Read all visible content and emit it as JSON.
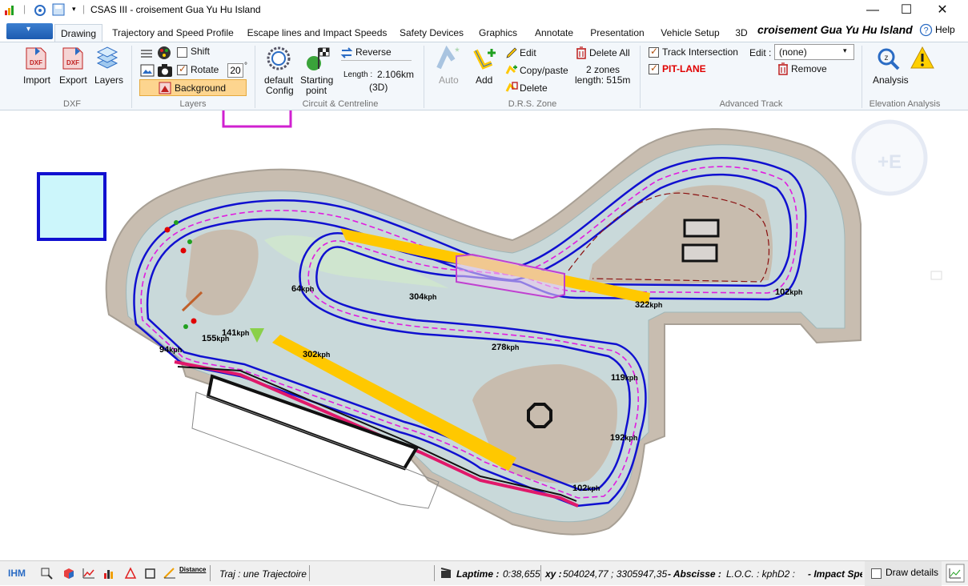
{
  "window": {
    "title": "CSAS III - croisement Gua Yu Hu Island",
    "controls": [
      "minimize-icon",
      "maximize-icon",
      "close-icon"
    ]
  },
  "tabs": [
    {
      "label": "Drawing",
      "active": true
    },
    {
      "label": "Trajectory and Speed Profile"
    },
    {
      "label": "Escape lines and Impact Speeds"
    },
    {
      "label": "Safety Devices"
    },
    {
      "label": "Graphics"
    },
    {
      "label": "Annotate"
    },
    {
      "label": "Presentation"
    },
    {
      "label": "Vehicle Setup"
    },
    {
      "label": "3D"
    }
  ],
  "project_name": "croisement Gua Yu Hu Island",
  "help_label": "Help",
  "ribbon": {
    "dxf": {
      "import": "Import",
      "export": "Export",
      "layers": "Layers",
      "group": "DXF"
    },
    "layers": {
      "shift": "Shift",
      "rotate": "Rotate",
      "rotate_value": "20",
      "rotate_unit": "°",
      "background": "Background",
      "group": "Layers"
    },
    "circuit": {
      "default_config": "default\nConfig",
      "default_1": "default",
      "default_2": "Config",
      "start_1": "Starting",
      "start_2": "point",
      "reverse": "Reverse",
      "length_label": "Length :",
      "length_value": "2.106km",
      "length_mode": "(3D)",
      "group": "Circuit & Centreline"
    },
    "drs": {
      "auto": "Auto",
      "add": "Add",
      "edit": "Edit",
      "copy_paste": "Copy/paste",
      "delete": "Delete",
      "delete_all": "Delete All",
      "zones": "2 zones",
      "zones_length": "length: 515m",
      "group": "D.R.S. Zone"
    },
    "advanced": {
      "track_intersection": "Track Intersection",
      "pit_lane": "PIT-LANE",
      "edit_label": "Edit :",
      "edit_value": "(none)",
      "remove": "Remove",
      "group": "Advanced Track"
    },
    "elevation": {
      "analysis": "Analysis",
      "group": "Elevation Analysis"
    }
  },
  "speed_labels": [
    {
      "value": "64",
      "unit": "kph"
    },
    {
      "value": "304",
      "unit": "kph"
    },
    {
      "value": "322",
      "unit": "kph"
    },
    {
      "value": "102",
      "unit": "kph"
    },
    {
      "value": "141",
      "unit": "kph"
    },
    {
      "value": "155",
      "unit": "kph"
    },
    {
      "value": "94",
      "unit": "kph"
    },
    {
      "value": "302",
      "unit": "kph"
    },
    {
      "value": "278",
      "unit": "kph"
    },
    {
      "value": "119",
      "unit": "kph"
    },
    {
      "value": "192",
      "unit": "kph"
    },
    {
      "value": "102",
      "unit": "kph"
    }
  ],
  "status": {
    "ihm": "IHM",
    "distance": "Distance",
    "traj": "Traj :  une Trajectoire",
    "laptime_label": "Laptime :",
    "laptime_value": "0:38,655",
    "xy_label": "xy :",
    "xy_value": "504024,77 ; 3305947,35",
    "abscisse": "- Abscisse :",
    "loc": "L.O.C. : kph",
    "d2": "D2 :",
    "impact": "- Impact Spe",
    "draw_details": "Draw details"
  },
  "colors": {
    "accent": "#2b6cc4",
    "ribbon_bg": "#f3f7fb",
    "runoff": "#c9d9da",
    "infield": "#c8bcae",
    "track_edge": "#1010d0",
    "trajectory": "#e01ce0",
    "drs": "#ffc800",
    "pit": "#e0186a"
  }
}
